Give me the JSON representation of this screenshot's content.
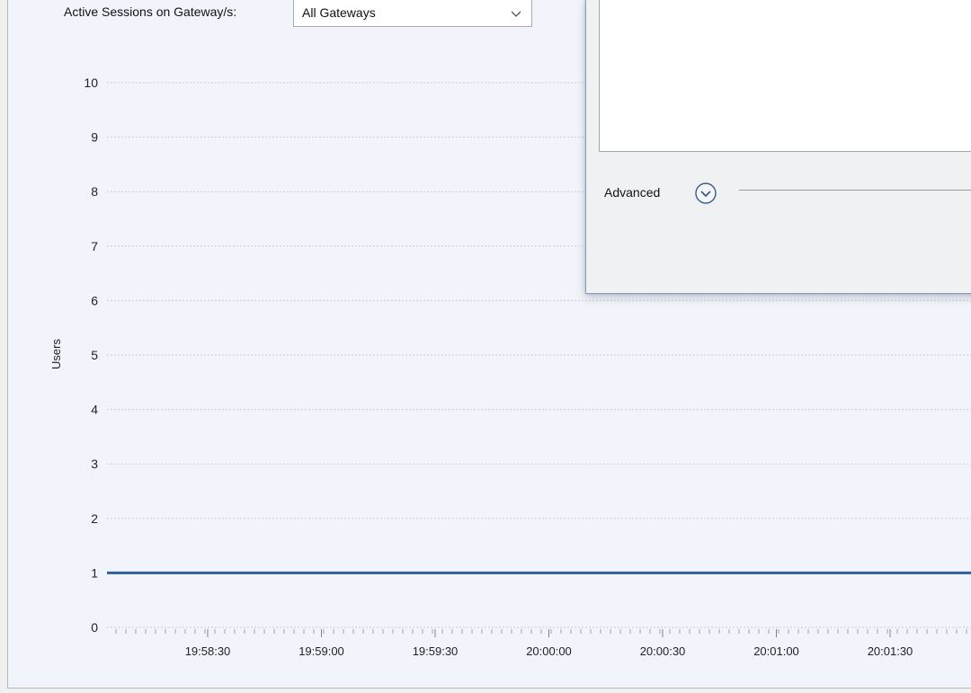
{
  "filter": {
    "label": "Active Sessions on Gateway/s:",
    "selected": "All Gateways"
  },
  "dialog": {
    "advanced_label": "Advanced"
  },
  "chart_data": {
    "type": "line",
    "ylabel": "Users",
    "ylim": [
      0,
      10
    ],
    "yticks": [
      0,
      1,
      2,
      3,
      4,
      5,
      6,
      7,
      8,
      9,
      10
    ],
    "xticks": [
      "19:58:30",
      "19:59:00",
      "19:59:30",
      "20:00:00",
      "20:00:30",
      "20:01:00",
      "20:01:30"
    ],
    "series": [
      {
        "values": [
          1,
          1,
          1,
          1,
          1,
          1,
          1,
          1,
          1
        ],
        "color": "#2e5f99"
      }
    ],
    "grid": true
  },
  "colors": {
    "panel_bg": "#f1f4fb",
    "series_line": "#2e5f99",
    "dialog_border": "#7f9fc3"
  }
}
